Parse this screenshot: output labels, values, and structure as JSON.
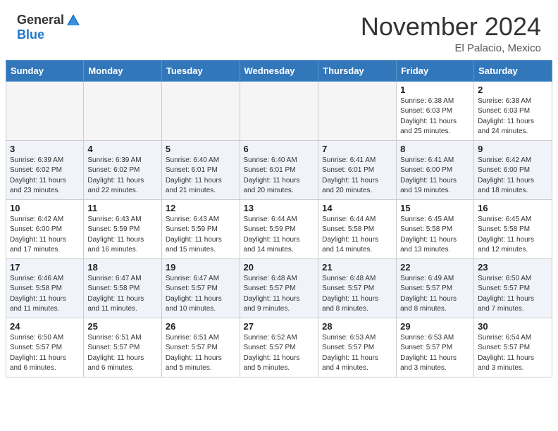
{
  "header": {
    "logo_general": "General",
    "logo_blue": "Blue",
    "month": "November 2024",
    "location": "El Palacio, Mexico"
  },
  "calendar": {
    "weekdays": [
      "Sunday",
      "Monday",
      "Tuesday",
      "Wednesday",
      "Thursday",
      "Friday",
      "Saturday"
    ],
    "weeks": [
      [
        {
          "day": "",
          "info": ""
        },
        {
          "day": "",
          "info": ""
        },
        {
          "day": "",
          "info": ""
        },
        {
          "day": "",
          "info": ""
        },
        {
          "day": "",
          "info": ""
        },
        {
          "day": "1",
          "info": "Sunrise: 6:38 AM\nSunset: 6:03 PM\nDaylight: 11 hours\nand 25 minutes."
        },
        {
          "day": "2",
          "info": "Sunrise: 6:38 AM\nSunset: 6:03 PM\nDaylight: 11 hours\nand 24 minutes."
        }
      ],
      [
        {
          "day": "3",
          "info": "Sunrise: 6:39 AM\nSunset: 6:02 PM\nDaylight: 11 hours\nand 23 minutes."
        },
        {
          "day": "4",
          "info": "Sunrise: 6:39 AM\nSunset: 6:02 PM\nDaylight: 11 hours\nand 22 minutes."
        },
        {
          "day": "5",
          "info": "Sunrise: 6:40 AM\nSunset: 6:01 PM\nDaylight: 11 hours\nand 21 minutes."
        },
        {
          "day": "6",
          "info": "Sunrise: 6:40 AM\nSunset: 6:01 PM\nDaylight: 11 hours\nand 20 minutes."
        },
        {
          "day": "7",
          "info": "Sunrise: 6:41 AM\nSunset: 6:01 PM\nDaylight: 11 hours\nand 20 minutes."
        },
        {
          "day": "8",
          "info": "Sunrise: 6:41 AM\nSunset: 6:00 PM\nDaylight: 11 hours\nand 19 minutes."
        },
        {
          "day": "9",
          "info": "Sunrise: 6:42 AM\nSunset: 6:00 PM\nDaylight: 11 hours\nand 18 minutes."
        }
      ],
      [
        {
          "day": "10",
          "info": "Sunrise: 6:42 AM\nSunset: 6:00 PM\nDaylight: 11 hours\nand 17 minutes."
        },
        {
          "day": "11",
          "info": "Sunrise: 6:43 AM\nSunset: 5:59 PM\nDaylight: 11 hours\nand 16 minutes."
        },
        {
          "day": "12",
          "info": "Sunrise: 6:43 AM\nSunset: 5:59 PM\nDaylight: 11 hours\nand 15 minutes."
        },
        {
          "day": "13",
          "info": "Sunrise: 6:44 AM\nSunset: 5:59 PM\nDaylight: 11 hours\nand 14 minutes."
        },
        {
          "day": "14",
          "info": "Sunrise: 6:44 AM\nSunset: 5:58 PM\nDaylight: 11 hours\nand 14 minutes."
        },
        {
          "day": "15",
          "info": "Sunrise: 6:45 AM\nSunset: 5:58 PM\nDaylight: 11 hours\nand 13 minutes."
        },
        {
          "day": "16",
          "info": "Sunrise: 6:45 AM\nSunset: 5:58 PM\nDaylight: 11 hours\nand 12 minutes."
        }
      ],
      [
        {
          "day": "17",
          "info": "Sunrise: 6:46 AM\nSunset: 5:58 PM\nDaylight: 11 hours\nand 11 minutes."
        },
        {
          "day": "18",
          "info": "Sunrise: 6:47 AM\nSunset: 5:58 PM\nDaylight: 11 hours\nand 11 minutes."
        },
        {
          "day": "19",
          "info": "Sunrise: 6:47 AM\nSunset: 5:57 PM\nDaylight: 11 hours\nand 10 minutes."
        },
        {
          "day": "20",
          "info": "Sunrise: 6:48 AM\nSunset: 5:57 PM\nDaylight: 11 hours\nand 9 minutes."
        },
        {
          "day": "21",
          "info": "Sunrise: 6:48 AM\nSunset: 5:57 PM\nDaylight: 11 hours\nand 8 minutes."
        },
        {
          "day": "22",
          "info": "Sunrise: 6:49 AM\nSunset: 5:57 PM\nDaylight: 11 hours\nand 8 minutes."
        },
        {
          "day": "23",
          "info": "Sunrise: 6:50 AM\nSunset: 5:57 PM\nDaylight: 11 hours\nand 7 minutes."
        }
      ],
      [
        {
          "day": "24",
          "info": "Sunrise: 6:50 AM\nSunset: 5:57 PM\nDaylight: 11 hours\nand 6 minutes."
        },
        {
          "day": "25",
          "info": "Sunrise: 6:51 AM\nSunset: 5:57 PM\nDaylight: 11 hours\nand 6 minutes."
        },
        {
          "day": "26",
          "info": "Sunrise: 6:51 AM\nSunset: 5:57 PM\nDaylight: 11 hours\nand 5 minutes."
        },
        {
          "day": "27",
          "info": "Sunrise: 6:52 AM\nSunset: 5:57 PM\nDaylight: 11 hours\nand 5 minutes."
        },
        {
          "day": "28",
          "info": "Sunrise: 6:53 AM\nSunset: 5:57 PM\nDaylight: 11 hours\nand 4 minutes."
        },
        {
          "day": "29",
          "info": "Sunrise: 6:53 AM\nSunset: 5:57 PM\nDaylight: 11 hours\nand 3 minutes."
        },
        {
          "day": "30",
          "info": "Sunrise: 6:54 AM\nSunset: 5:57 PM\nDaylight: 11 hours\nand 3 minutes."
        }
      ]
    ]
  }
}
